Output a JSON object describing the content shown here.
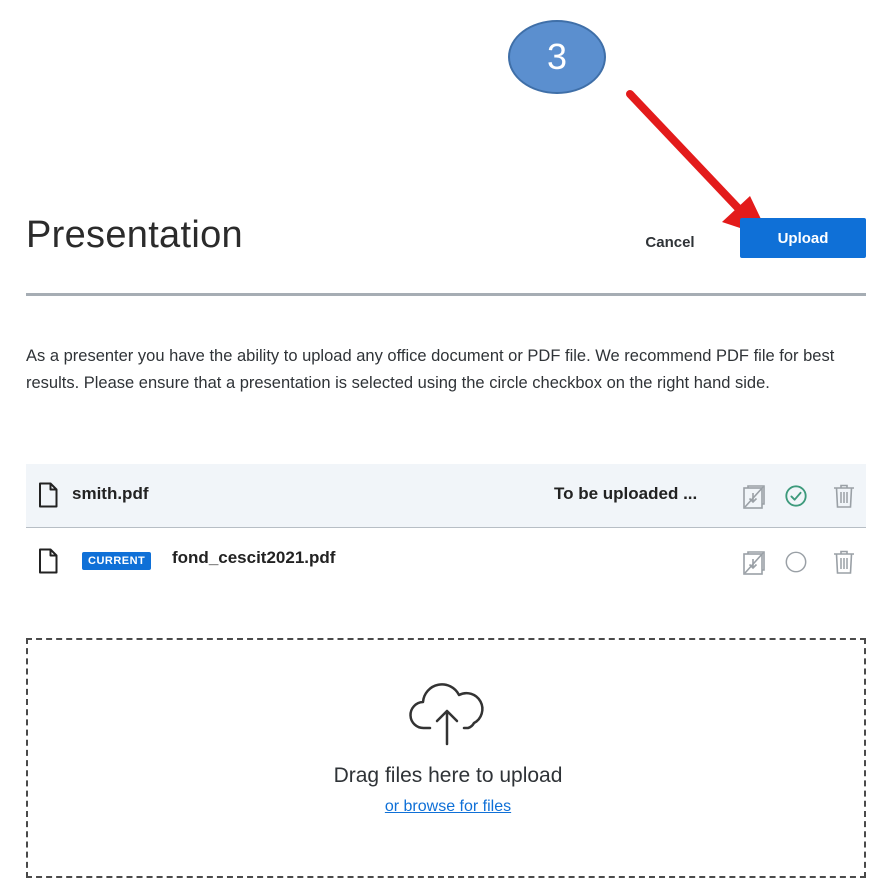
{
  "annotation": {
    "step_number": "3"
  },
  "dialog": {
    "title": "Presentation",
    "cancel_label": "Cancel",
    "upload_label": "Upload",
    "description": "As a presenter you have the ability to upload any office document or PDF file. We recommend PDF file for best results. Please ensure that a presentation is selected using the circle checkbox on the right hand side."
  },
  "files": [
    {
      "name": "smith.pdf",
      "status": "To be uploaded ...",
      "badge": "",
      "selected": true
    },
    {
      "name": "fond_cescit2021.pdf",
      "status": "",
      "badge": "CURRENT",
      "selected": false
    }
  ],
  "dropzone": {
    "title": "Drag files here to upload",
    "browse_label": "or browse for files"
  },
  "colors": {
    "primary": "#0f70d7",
    "selected_check": "#3d9a7c",
    "annotation_circle": "#5b8fcf",
    "annotation_arrow": "#e31b1b"
  },
  "icons": [
    "file-icon",
    "download-disabled-icon",
    "check-circle-icon",
    "circle-icon",
    "trash-icon",
    "cloud-upload-icon"
  ]
}
